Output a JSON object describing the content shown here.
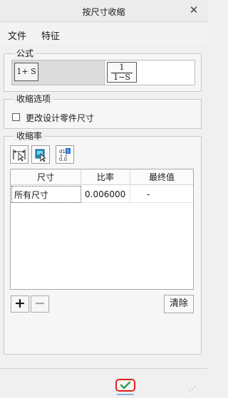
{
  "window": {
    "title": "按尺寸收缩",
    "close_icon": "close-icon"
  },
  "menu": {
    "items": [
      "文件",
      "特征"
    ]
  },
  "formula_group": {
    "legend": "公式",
    "option_left": "1+ S",
    "option_right": {
      "numerator": "1",
      "denominator": "1−S"
    },
    "selected": "left"
  },
  "shrink_options_group": {
    "legend": "收缩选项",
    "checkbox_label": "更改设计零件尺寸",
    "checked": false
  },
  "shrink_rate_group": {
    "legend": "收缩率",
    "tool_icons": [
      "select-dimension-icon",
      "select-feature-icon",
      "dimension-value-toggle-icon"
    ],
    "table": {
      "columns": [
        "尺寸",
        "比率",
        "最终值"
      ],
      "rows": [
        {
          "dimension": "所有尺寸",
          "ratio": "0.006000",
          "final": "-"
        }
      ]
    },
    "clear_label": "清除"
  },
  "footer": {
    "ok_icon": "confirm-check-icon"
  },
  "colors": {
    "ok_highlight": "#e0201c",
    "ok_check": "#2f9e44"
  }
}
